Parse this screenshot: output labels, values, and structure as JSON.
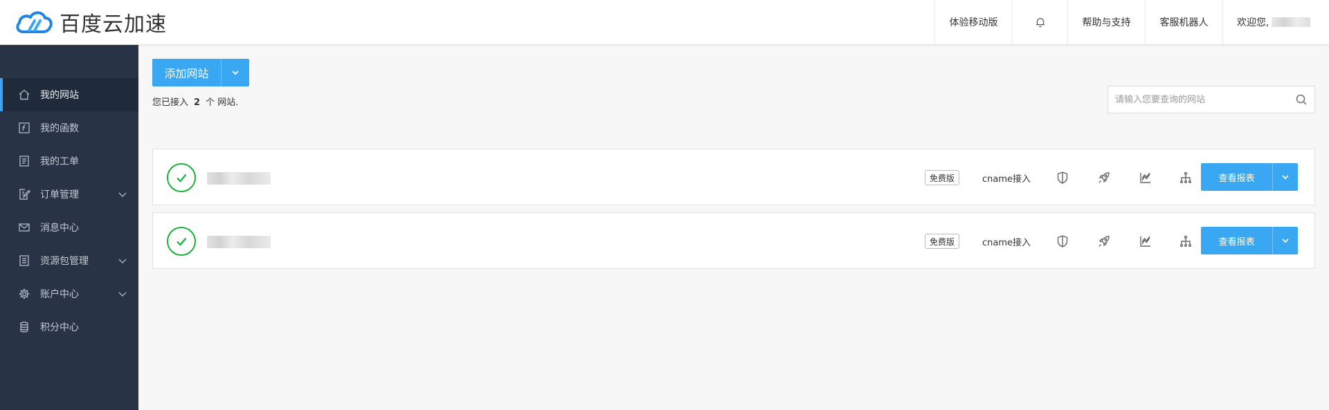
{
  "app": {
    "title": "百度云加速"
  },
  "header": {
    "mobile": "体验移动版",
    "help": "帮助与支持",
    "robot": "客服机器人",
    "welcome": "欢迎您,"
  },
  "sidebar": {
    "items": [
      {
        "label": "我的网站",
        "icon": "home-icon"
      },
      {
        "label": "我的函数",
        "icon": "function-icon"
      },
      {
        "label": "我的工单",
        "icon": "ticket-icon"
      },
      {
        "label": "订单管理",
        "icon": "order-icon"
      },
      {
        "label": "消息中心",
        "icon": "mail-icon"
      },
      {
        "label": "资源包管理",
        "icon": "package-icon"
      },
      {
        "label": "账户中心",
        "icon": "gear-icon"
      },
      {
        "label": "积分中心",
        "icon": "database-icon"
      }
    ]
  },
  "main": {
    "add_site_label": "添加网站",
    "count_prefix": "您已接入",
    "count": "2",
    "count_suffix": "个 网站.",
    "search_placeholder": "请输入您要查询的网站",
    "sites": [
      {
        "plan": "免费版",
        "access": "cname接入",
        "report_label": "查看报表"
      },
      {
        "plan": "免费版",
        "access": "cname接入",
        "report_label": "查看报表"
      }
    ]
  },
  "colors": {
    "accent": "#3aa7f2",
    "sidebar_bg": "#283446",
    "status_ok": "#19b23b"
  }
}
